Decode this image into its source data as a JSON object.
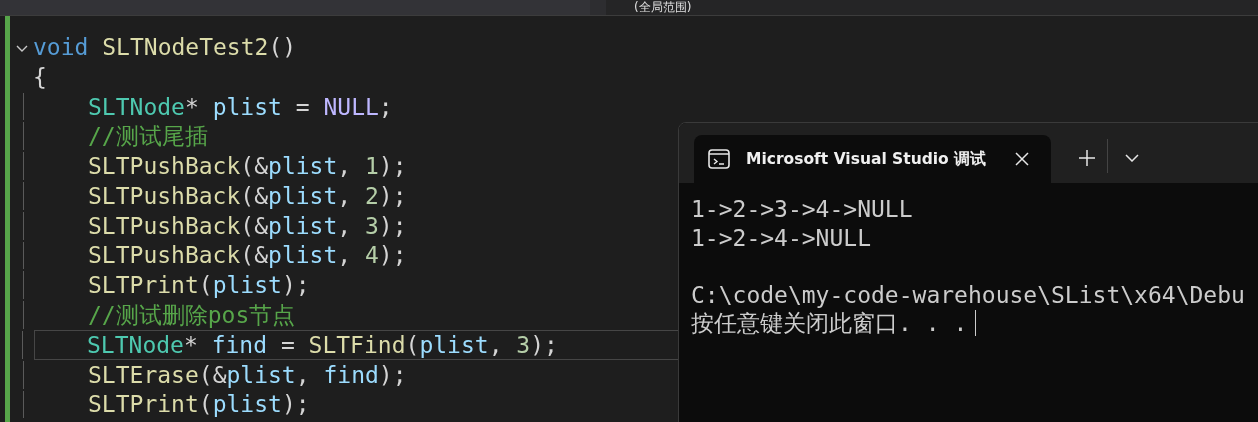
{
  "scope_dropdown": {
    "value": "(全局范围)"
  },
  "code_lines": [
    {
      "foldable": true,
      "current": false,
      "tokens": [
        {
          "kind": "keyword",
          "text": "void "
        },
        {
          "kind": "function",
          "text": "SLTNodeTest2"
        },
        {
          "kind": "plain",
          "text": "()"
        }
      ]
    },
    {
      "foldable": false,
      "current": false,
      "tokens": [
        {
          "kind": "plain",
          "text": "{"
        }
      ],
      "children": [
        {
          "foldable": false,
          "current": false,
          "tokens": [
            {
              "kind": "type",
              "text": "SLTNode"
            },
            {
              "kind": "plain",
              "text": "* "
            },
            {
              "kind": "variable",
              "text": "plist"
            },
            {
              "kind": "plain",
              "text": " = "
            },
            {
              "kind": "macro",
              "text": "NULL"
            },
            {
              "kind": "plain",
              "text": ";"
            }
          ]
        },
        {
          "foldable": false,
          "current": false,
          "tokens": [
            {
              "kind": "comment",
              "text": "//测试尾插"
            }
          ]
        },
        {
          "foldable": false,
          "current": false,
          "tokens": [
            {
              "kind": "function",
              "text": "SLTPushBack"
            },
            {
              "kind": "plain",
              "text": "(&"
            },
            {
              "kind": "variable",
              "text": "plist"
            },
            {
              "kind": "plain",
              "text": ", "
            },
            {
              "kind": "number",
              "text": "1"
            },
            {
              "kind": "plain",
              "text": ");"
            }
          ]
        },
        {
          "foldable": false,
          "current": false,
          "tokens": [
            {
              "kind": "function",
              "text": "SLTPushBack"
            },
            {
              "kind": "plain",
              "text": "(&"
            },
            {
              "kind": "variable",
              "text": "plist"
            },
            {
              "kind": "plain",
              "text": ", "
            },
            {
              "kind": "number",
              "text": "2"
            },
            {
              "kind": "plain",
              "text": ");"
            }
          ]
        },
        {
          "foldable": false,
          "current": false,
          "tokens": [
            {
              "kind": "function",
              "text": "SLTPushBack"
            },
            {
              "kind": "plain",
              "text": "(&"
            },
            {
              "kind": "variable",
              "text": "plist"
            },
            {
              "kind": "plain",
              "text": ", "
            },
            {
              "kind": "number",
              "text": "3"
            },
            {
              "kind": "plain",
              "text": ");"
            }
          ]
        },
        {
          "foldable": false,
          "current": false,
          "tokens": [
            {
              "kind": "function",
              "text": "SLTPushBack"
            },
            {
              "kind": "plain",
              "text": "(&"
            },
            {
              "kind": "variable",
              "text": "plist"
            },
            {
              "kind": "plain",
              "text": ", "
            },
            {
              "kind": "number",
              "text": "4"
            },
            {
              "kind": "plain",
              "text": ");"
            }
          ]
        },
        {
          "foldable": false,
          "current": false,
          "tokens": [
            {
              "kind": "function",
              "text": "SLTPrint"
            },
            {
              "kind": "plain",
              "text": "("
            },
            {
              "kind": "variable",
              "text": "plist"
            },
            {
              "kind": "plain",
              "text": ");"
            }
          ]
        },
        {
          "foldable": false,
          "current": false,
          "tokens": [
            {
              "kind": "comment",
              "text": "//测试删除pos节点"
            }
          ]
        },
        {
          "foldable": false,
          "current": true,
          "tokens": [
            {
              "kind": "type",
              "text": "SLTNode"
            },
            {
              "kind": "plain",
              "text": "* "
            },
            {
              "kind": "variable",
              "text": "find"
            },
            {
              "kind": "plain",
              "text": " = "
            },
            {
              "kind": "function",
              "text": "SLTFind"
            },
            {
              "kind": "plain",
              "text": "("
            },
            {
              "kind": "variable",
              "text": "plist"
            },
            {
              "kind": "plain",
              "text": ", "
            },
            {
              "kind": "number",
              "text": "3"
            },
            {
              "kind": "plain",
              "text": ");"
            }
          ]
        },
        {
          "foldable": false,
          "current": false,
          "tokens": [
            {
              "kind": "function",
              "text": "SLTErase"
            },
            {
              "kind": "plain",
              "text": "(&"
            },
            {
              "kind": "variable",
              "text": "plist"
            },
            {
              "kind": "plain",
              "text": ", "
            },
            {
              "kind": "variable",
              "text": "find"
            },
            {
              "kind": "plain",
              "text": ");"
            }
          ]
        },
        {
          "foldable": false,
          "current": false,
          "tokens": [
            {
              "kind": "function",
              "text": "SLTPrint"
            },
            {
              "kind": "plain",
              "text": "("
            },
            {
              "kind": "variable",
              "text": "plist"
            },
            {
              "kind": "plain",
              "text": ");"
            }
          ]
        }
      ]
    }
  ],
  "console": {
    "tab_title": "Microsoft Visual Studio 调试",
    "cursor_visible": true,
    "output": [
      [
        "1->2->3->4->NULL",
        "1->2->4->NULL"
      ],
      [
        "C:\\code\\my-code-warehouse\\SList\\x64\\Debu",
        "按任意键关闭此窗口. . ."
      ]
    ]
  }
}
